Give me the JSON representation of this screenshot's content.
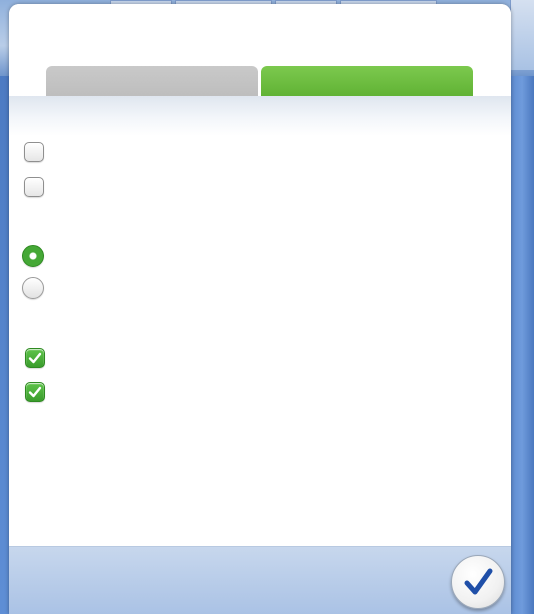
{
  "window": {
    "title": ""
  },
  "tabs": [
    {
      "label": "",
      "active": false,
      "color": "#c4c4c4"
    },
    {
      "label": "",
      "active": true,
      "color": "#6abd3f"
    }
  ],
  "options": {
    "checkboxes_group1": [
      {
        "label": "",
        "checked": false
      },
      {
        "label": "",
        "checked": false
      }
    ],
    "radio_group": [
      {
        "label": "",
        "selected": true
      },
      {
        "label": "",
        "selected": false
      }
    ],
    "checkboxes_group2": [
      {
        "label": "",
        "checked": true
      },
      {
        "label": "",
        "checked": true
      }
    ]
  },
  "footer": {
    "ok_icon": "checkmark-icon"
  },
  "colors": {
    "accent_green": "#4aaa35",
    "tab_inactive": "#c4c4c4",
    "footer_blue": "#b7cbe8",
    "check_blue": "#1f4fa8"
  }
}
